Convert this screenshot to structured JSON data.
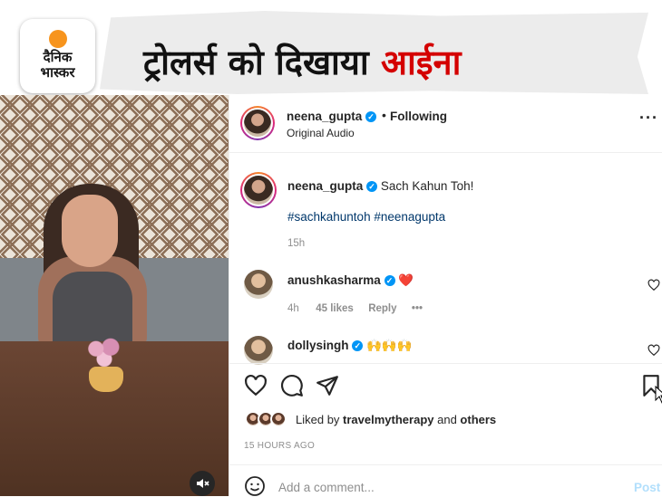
{
  "banner": {
    "logo_line1": "दैनिक",
    "logo_line2": "भास्कर",
    "headline_main": "ट्रोलर्स को दिखाया ",
    "headline_accent": "आईना",
    "accent_color": "#d40000"
  },
  "video": {
    "mute_icon": "speaker-muted-icon"
  },
  "post_header": {
    "username": "neena_gupta",
    "separator": "•",
    "follow_status": "Following",
    "audio": "Original Audio",
    "more_icon": "more-horizontal-icon"
  },
  "caption": {
    "username": "neena_gupta",
    "text": "Sach Kahun Toh!",
    "hashtags": "#sachkahuntoh #neenagupta",
    "time": "15h"
  },
  "comments": [
    {
      "username": "anushkasharma",
      "text": "❤️",
      "time": "4h",
      "likes": "45 likes",
      "reply": "Reply",
      "more": "•••"
    },
    {
      "username": "dollysingh",
      "text": "🙌🙌🙌"
    }
  ],
  "actions": {
    "like_icon": "heart-icon",
    "comment_icon": "comment-icon",
    "share_icon": "send-icon",
    "save_icon": "bookmark-icon"
  },
  "likes": {
    "prefix": "Liked by ",
    "user": "travelmytherapy",
    "middle": " and ",
    "others": "others"
  },
  "posted": "15 HOURS AGO",
  "comment_box": {
    "placeholder": "Add a comment...",
    "post_label": "Post"
  },
  "colors": {
    "verified_blue": "#0095f6",
    "hashtag_blue": "#00376b",
    "muted_text": "#8e8e8e",
    "post_disabled": "#b2dffc"
  }
}
